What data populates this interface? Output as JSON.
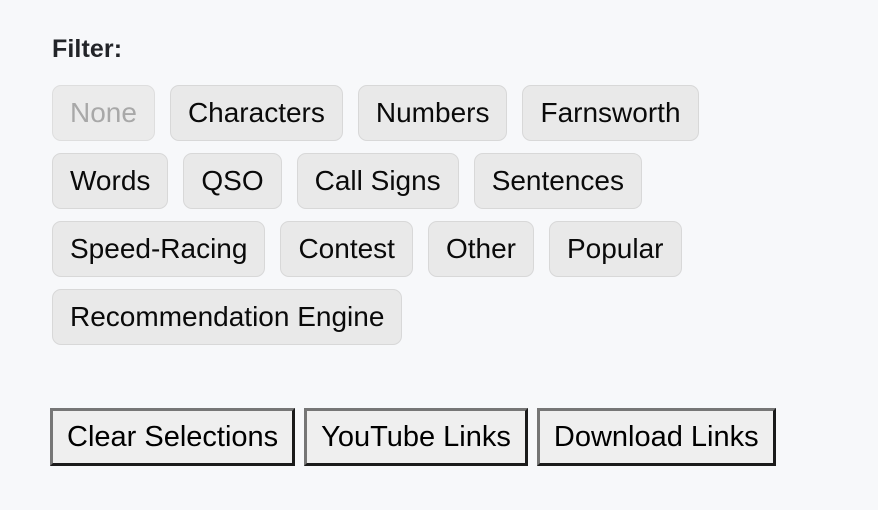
{
  "page": {
    "background_color": "#f7f8fa"
  },
  "filter_section": {
    "label": "Filter:",
    "rows": [
      [
        {
          "label": "None",
          "disabled": true
        },
        {
          "label": "Characters",
          "disabled": false
        },
        {
          "label": "Numbers",
          "disabled": false
        },
        {
          "label": "Farnsworth",
          "disabled": false
        }
      ],
      [
        {
          "label": "Words",
          "disabled": false
        },
        {
          "label": "QSO",
          "disabled": false
        },
        {
          "label": "Call Signs",
          "disabled": false
        },
        {
          "label": "Sentences",
          "disabled": false
        }
      ],
      [
        {
          "label": "Speed-Racing",
          "disabled": false
        },
        {
          "label": "Contest",
          "disabled": false
        },
        {
          "label": "Other",
          "disabled": false
        },
        {
          "label": "Popular",
          "disabled": false
        }
      ],
      [
        {
          "label": "Recommendation Engine",
          "disabled": false
        }
      ]
    ],
    "pill_fill_color": "#e9e9e9",
    "pill_border_color": "#d8d8d8",
    "pill_text_color": "#0a0a0a",
    "pill_disabled_text_color": "#a8a8a8"
  },
  "actions": {
    "buttons": [
      {
        "label": "Clear Selections"
      },
      {
        "label": "YouTube Links"
      },
      {
        "label": "Download Links"
      }
    ],
    "fill_color": "#efefef",
    "bevel_light_color": "#767676",
    "bevel_dark_color": "#1b1b1b",
    "text_color": "#000000"
  }
}
